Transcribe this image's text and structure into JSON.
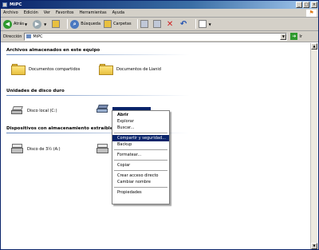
{
  "window": {
    "title": "MiPC"
  },
  "menubar": {
    "items": [
      "Archivo",
      "Edición",
      "Ver",
      "Favoritos",
      "Herramientas",
      "Ayuda"
    ]
  },
  "toolbar": {
    "back_label": "Atrás",
    "search_label": "Búsqueda",
    "folders_label": "Carpetas"
  },
  "address": {
    "label": "Dirección",
    "value": "MiPC",
    "go_label": "Ir"
  },
  "groups": {
    "stored_files": "Archivos almacenados en este equipo",
    "hard_drives": "Unidades de disco duro",
    "removable": "Dispositivos con almacenamiento extraíble"
  },
  "items": {
    "shared_docs": "Documentos compartidos",
    "user_docs": "Documentos de Lianid",
    "local_disk": "Disco local (C:)",
    "floppy": "Disco de 3½ (A:)",
    "cd_drive": ""
  },
  "context_menu": {
    "open": "Abrir",
    "explore": "Explorar",
    "search": "Buscar...",
    "sharing": "Compartir y seguridad...",
    "backup": "Backup",
    "format": "Formatear...",
    "copy": "Copiar",
    "shortcut": "Crear acceso directo",
    "rename": "Cambiar nombre",
    "properties": "Propiedades"
  },
  "colors": {
    "selection": "#0a246a",
    "titlebar": "#0a246a",
    "chrome": "#d4d0c8"
  }
}
